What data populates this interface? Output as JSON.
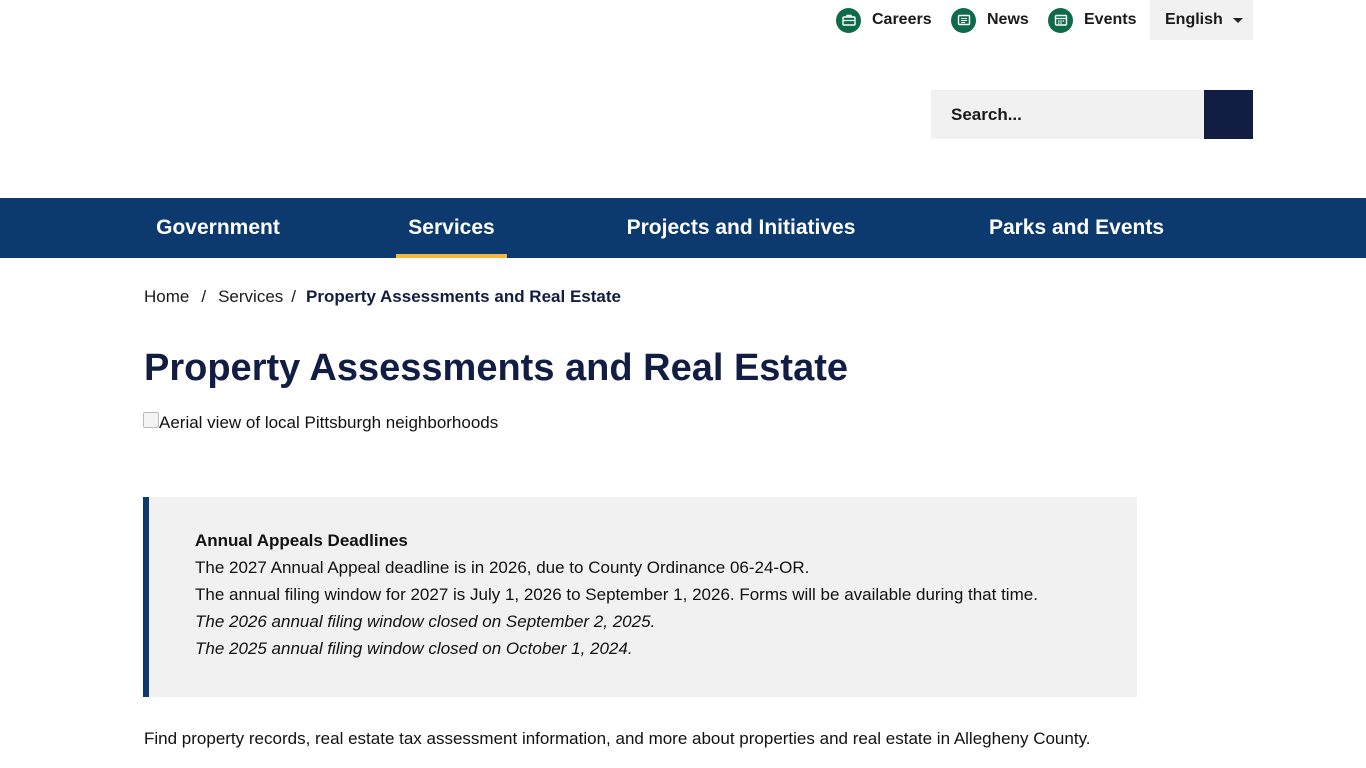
{
  "utility": {
    "links": [
      {
        "label": "Careers",
        "icon": "briefcase-icon"
      },
      {
        "label": "News",
        "icon": "newspaper-icon"
      },
      {
        "label": "Events",
        "icon": "calendar-icon"
      }
    ],
    "language": "English"
  },
  "search": {
    "placeholder": "Search...",
    "button_icon": "search-icon"
  },
  "nav": {
    "items": [
      {
        "label": "Government"
      },
      {
        "label": "Services"
      },
      {
        "label": "Projects and Initiatives"
      },
      {
        "label": "Parks and Events"
      }
    ],
    "active": "Services"
  },
  "breadcrumb": {
    "home": "Home",
    "sep": "/",
    "parent": "Services",
    "current": "Property Assessments and Real Estate"
  },
  "page": {
    "title": "Property Assessments and Real Estate",
    "image_alt": "Aerial view of local Pittsburgh neighborhoods",
    "intro": "Find property records, real estate tax assessment information, and more about properties and real estate in Allegheny County."
  },
  "notice": {
    "heading": "Annual Appeals Deadlines",
    "line1": "The 2027 Annual Appeal deadline is in 2026, due to County Ordinance 06-24-OR.",
    "line2": "The annual filing window for 2027 is July 1, 2026 to September 1, 2026. Forms will be available during that time.",
    "line3": "The 2026 annual filing window closed on September 2, 2025.",
    "line4": "The 2025 annual filing window closed on October 1, 2024."
  },
  "colors": {
    "nav_bg": "#0c3a6f",
    "nav_active_underline": "#f6b73c",
    "title": "#111d42",
    "utility_icon": "#0d6b4a",
    "search_button": "#111d42",
    "notice_bg": "#f1f1f1"
  }
}
